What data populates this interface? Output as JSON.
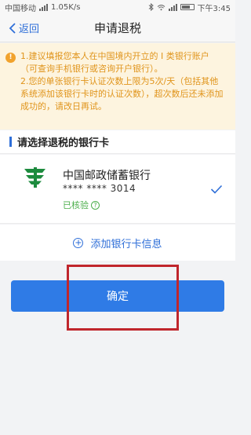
{
  "status_bar": {
    "carrier": "中国移动",
    "speed": "1.05K/s",
    "time": "下午3:45"
  },
  "nav": {
    "back_label": "返回",
    "title": "申请退税"
  },
  "notice": {
    "line1": "1.建议填报您本人在中国境内开立的 I 类银行账户（可查询手机银行或咨询开户银行）。",
    "line2": "2.您的单张银行卡认证次数上限为5次/天（包括其他系统添加该银行卡时的认证次数），超次数后还未添加成功的，请改日再试。"
  },
  "section": {
    "title": "请选择退税的银行卡"
  },
  "card": {
    "bank_name": "中国邮政储蓄银行",
    "number": "**** **** 3014",
    "verified_label": "已核验",
    "verified_help": "?",
    "selected": true,
    "logo_icon": "postal-savings-bank-logo-icon"
  },
  "add_card": {
    "label": "添加银行卡信息"
  },
  "actions": {
    "confirm_label": "确定"
  },
  "colors": {
    "accent": "#2f7be6",
    "link": "#2f6fd8",
    "notice_text": "#e0941b",
    "notice_bg": "#fdf4df",
    "verified": "#4cae4c",
    "bank_green": "#1d8b3e",
    "highlight": "#c0262c"
  }
}
